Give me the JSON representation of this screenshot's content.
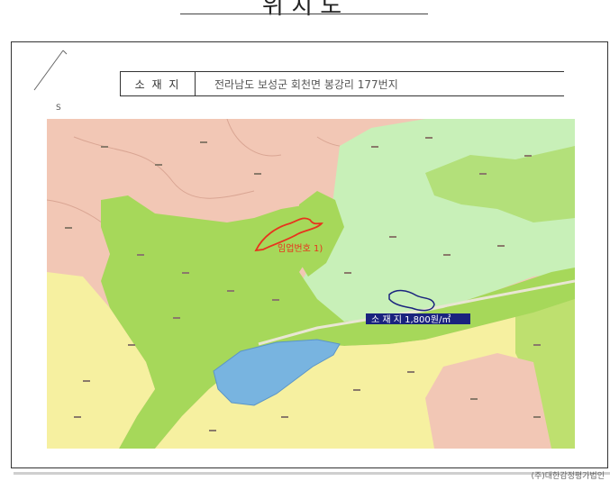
{
  "document": {
    "title": "위   치   도",
    "address_label": "소 재 지",
    "address_value": "전라남도 보성군 회천면 봉강리 177번지",
    "corner_mark": "S",
    "footer": "(주)대한감정평가법인"
  },
  "map": {
    "labels": {
      "forest_id": "임업번호 1)",
      "subject_price": "소 재 지 1,800원/㎡"
    },
    "colors": {
      "background_pink": "#f2c7b5",
      "light_green": "#c8f0b8",
      "green": "#a6d85a",
      "yellow": "#f6f0a0",
      "water": "#78b4e0",
      "red_outline": "#e8331d",
      "blue_outline": "#1a237e"
    }
  }
}
